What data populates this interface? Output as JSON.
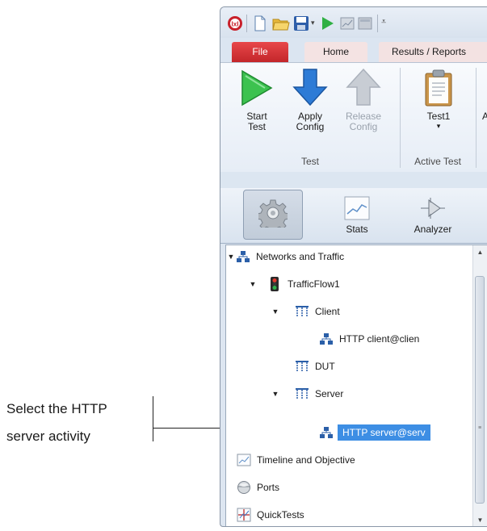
{
  "callout": {
    "line1": "Select the HTTP",
    "line2": "server activity"
  },
  "tabs": {
    "file": "File",
    "home": "Home",
    "results": "Results / Reports"
  },
  "ribbon": {
    "buttons": {
      "start_test": "Start\nTest",
      "apply_config": "Apply\nConfig",
      "release_config": "Release\nConfig",
      "active_test": "Test1"
    },
    "groups": {
      "test": "Test",
      "active_test": "Active Test"
    }
  },
  "nav": {
    "stats": "Stats",
    "analyzer": "Analyzer"
  },
  "tree": {
    "networks_and_traffic": "Networks and Traffic",
    "traffic_flow": "TrafficFlow1",
    "client": "Client",
    "http_client": "HTTP client@clien",
    "dut": "DUT",
    "server": "Server",
    "http_server": "HTTP server@serv",
    "timeline": "Timeline and Objective",
    "ports": "Ports",
    "quicktests": "QuickTests"
  },
  "colors": {
    "accent_selected": "#3d8ee4",
    "file_tab": "#c3262a",
    "play_green": "#2fb043",
    "apply_blue": "#2d7bd6"
  },
  "icons": {
    "app_logo": "app-logo-icon",
    "new": "new-document-icon",
    "open": "open-folder-icon",
    "save": "save-icon",
    "run": "play-icon",
    "network": "network-icon",
    "traffic_light": "traffic-light-icon",
    "port_role": "port-role-icon",
    "timeline": "chart-icon",
    "ports": "port-sphere-icon",
    "quicktests": "quicktest-icon"
  }
}
